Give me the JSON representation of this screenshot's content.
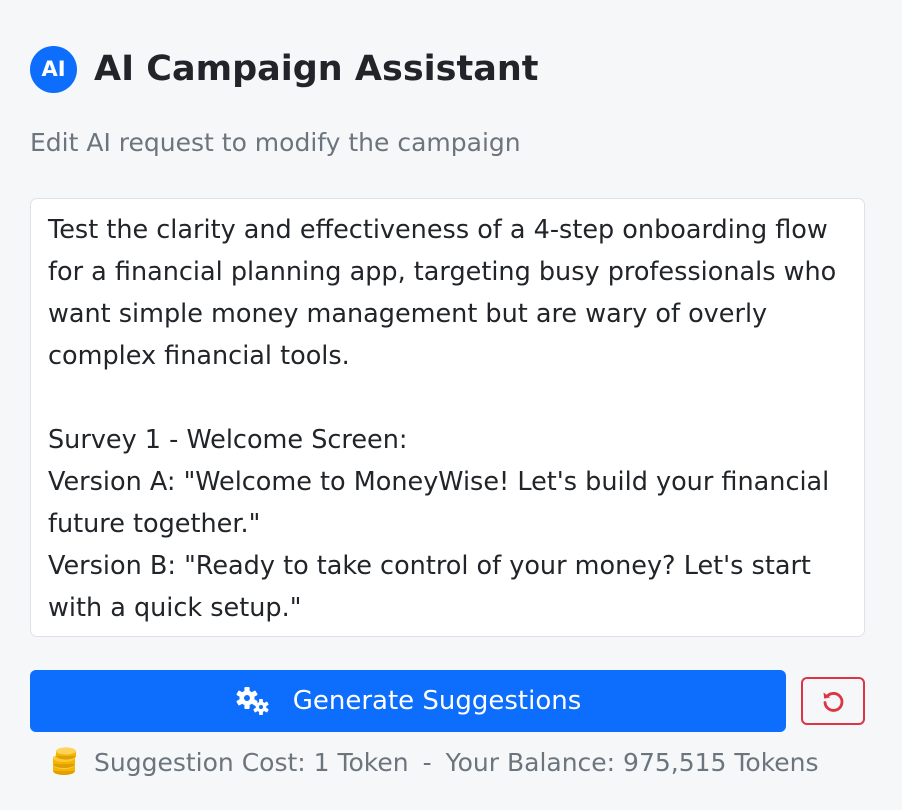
{
  "header": {
    "badge_text": "AI",
    "title": "AI Campaign Assistant"
  },
  "subtitle": "Edit AI request to modify the campaign",
  "request": {
    "text": "Test the clarity and effectiveness of a 4-step onboarding flow for a financial planning app, targeting busy professionals who want simple money management but are wary of overly complex financial tools.\n\nSurvey 1 - Welcome Screen:\nVersion A: \"Welcome to MoneyWise! Let's build your financial future together.\"\nVersion B: \"Ready to take control of your money? Let's start with a quick setup.\""
  },
  "actions": {
    "generate_label": "Generate Suggestions",
    "generate_icon": "gears-icon",
    "reset_icon": "undo-icon"
  },
  "cost": {
    "icon": "coins-icon",
    "cost_text": "Suggestion Cost: 1 Token",
    "separator": "-",
    "balance_text": "Your Balance: 975,515 Tokens"
  },
  "colors": {
    "primary": "#0d6efd",
    "danger": "#dc3545",
    "muted": "#6c757d",
    "coin": "#f5b400"
  }
}
